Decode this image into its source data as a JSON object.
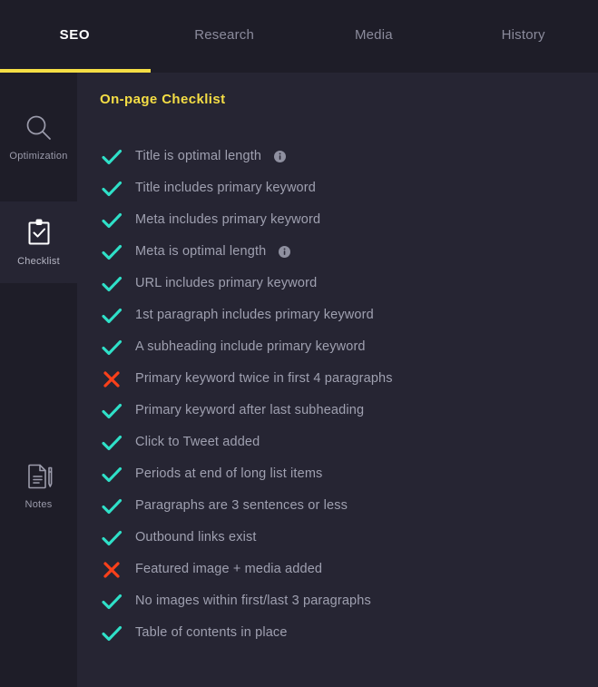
{
  "tabs": [
    {
      "label": "SEO",
      "active": true
    },
    {
      "label": "Research",
      "active": false
    },
    {
      "label": "Media",
      "active": false
    },
    {
      "label": "History",
      "active": false
    }
  ],
  "sidebar": {
    "items": [
      {
        "label": "Optimization",
        "icon": "magnifier-icon",
        "active": false
      },
      {
        "label": "Checklist",
        "icon": "clipboard-check-icon",
        "active": true
      },
      {
        "label": "Notes",
        "icon": "document-pen-icon",
        "active": false
      }
    ]
  },
  "main": {
    "title": "On-page Checklist",
    "items": [
      {
        "label": "Title is optimal length",
        "status": "pass",
        "info": true
      },
      {
        "label": "Title includes primary keyword",
        "status": "pass",
        "info": false
      },
      {
        "label": "Meta includes primary keyword",
        "status": "pass",
        "info": false
      },
      {
        "label": "Meta is optimal length",
        "status": "pass",
        "info": true
      },
      {
        "label": "URL includes primary keyword",
        "status": "pass",
        "info": false
      },
      {
        "label": "1st paragraph includes primary keyword",
        "status": "pass",
        "info": false
      },
      {
        "label": "A subheading include primary keyword",
        "status": "pass",
        "info": false
      },
      {
        "label": "Primary keyword twice in first 4 paragraphs",
        "status": "fail",
        "info": false
      },
      {
        "label": "Primary keyword after last subheading",
        "status": "pass",
        "info": false
      },
      {
        "label": "Click to Tweet added",
        "status": "pass",
        "info": false
      },
      {
        "label": "Periods at end of long list items",
        "status": "pass",
        "info": false
      },
      {
        "label": "Paragraphs are 3 sentences or less",
        "status": "pass",
        "info": false
      },
      {
        "label": "Outbound links exist",
        "status": "pass",
        "info": false
      },
      {
        "label": "Featured image + media added",
        "status": "fail",
        "info": false
      },
      {
        "label": "No images within first/last 3 paragraphs",
        "status": "pass",
        "info": false
      },
      {
        "label": "Table of contents in place",
        "status": "pass",
        "info": false
      }
    ]
  },
  "colors": {
    "window_background": "#1e1d28",
    "panel_background": "#262533",
    "accent_yellow": "#f5de45",
    "pass_teal": "#2fe0c8",
    "fail_orange": "#f9401a",
    "text_muted": "#9fa0b0",
    "text_active": "#ffffff"
  }
}
